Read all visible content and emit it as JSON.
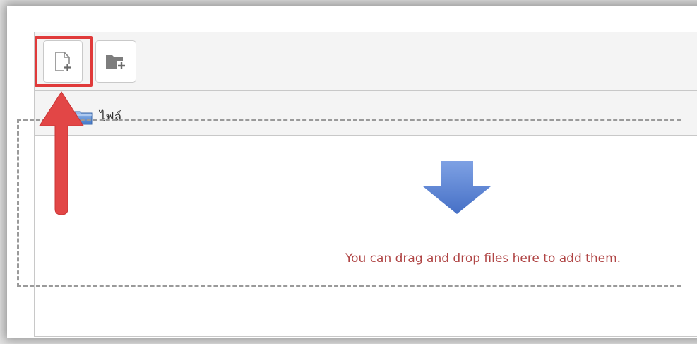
{
  "toolbar": {
    "buttons": [
      {
        "name": "add-file",
        "icon": "file-plus-icon"
      },
      {
        "name": "create-folder",
        "icon": "folder-plus-icon"
      }
    ]
  },
  "path": {
    "icon": "folder-icon",
    "label": "ไฟล์"
  },
  "dropzone": {
    "icon": "arrow-down-icon",
    "message": "You can drag and drop files here to add them.",
    "message_color": "#b04545",
    "arrow_color": "#5b83d4"
  },
  "annotation": {
    "highlight_color": "#e03a3a",
    "pointer_icon": "arrow-up-icon"
  }
}
